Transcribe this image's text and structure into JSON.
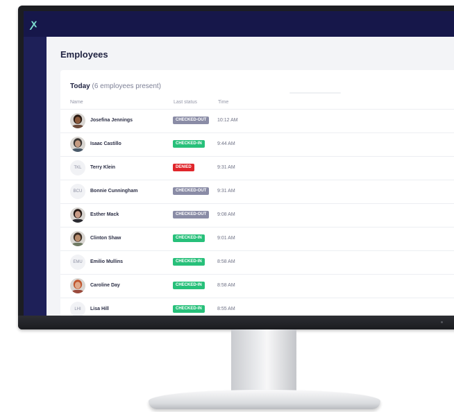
{
  "app": {
    "logo_glyph": "ꭗ",
    "accent": "#16174a"
  },
  "page": {
    "title": "Employees"
  },
  "card": {
    "title": "Today",
    "subtitle": "(6 employees present)"
  },
  "columns": {
    "name": "Name",
    "status": "Last status",
    "time": "Time"
  },
  "status_colors": {
    "CHECKED-OUT": "#8a8ca6",
    "CHECKED-IN": "#27c07a",
    "DENIED": "#e0262b"
  },
  "employees": [
    {
      "name": "Josefina Jennings",
      "status": "CHECKED-OUT",
      "time": "10:12 AM",
      "avatar": "photo",
      "initials": "",
      "skin": "#8b5a3c",
      "hair": "#2a1a12",
      "shirt": "#6b4a3a"
    },
    {
      "name": "Isaac Castillo",
      "status": "CHECKED-IN",
      "time": "9:44 AM",
      "avatar": "photo",
      "initials": "",
      "skin": "#c49b82",
      "hair": "#3a3532",
      "shirt": "#4a5a6a"
    },
    {
      "name": "Terry Klein",
      "status": "DENIED",
      "time": "9:31 AM",
      "avatar": "initials",
      "initials": "TKL"
    },
    {
      "name": "Bonnie Cunningham",
      "status": "CHECKED-OUT",
      "time": "9:31 AM",
      "avatar": "initials",
      "initials": "BCU"
    },
    {
      "name": "Esther Mack",
      "status": "CHECKED-OUT",
      "time": "9:08 AM",
      "avatar": "photo",
      "initials": "",
      "skin": "#c79b86",
      "hair": "#241814",
      "shirt": "#2a2a30"
    },
    {
      "name": "Clinton Shaw",
      "status": "CHECKED-IN",
      "time": "9:01 AM",
      "avatar": "photo",
      "initials": "",
      "skin": "#b78b6b",
      "hair": "#3b2c22",
      "shirt": "#6f7a63"
    },
    {
      "name": "Emilio Mullins",
      "status": "CHECKED-IN",
      "time": "8:58 AM",
      "avatar": "initials",
      "initials": "EMU"
    },
    {
      "name": "Caroline Day",
      "status": "CHECKED-IN",
      "time": "8:58 AM",
      "avatar": "photo",
      "initials": "",
      "skin": "#e0a98a",
      "hair": "#c0562e",
      "shirt": "#9a4a3c"
    },
    {
      "name": "Lisa Hill",
      "status": "CHECKED-IN",
      "time": "8:55 AM",
      "avatar": "initials",
      "initials": "LHI"
    }
  ]
}
